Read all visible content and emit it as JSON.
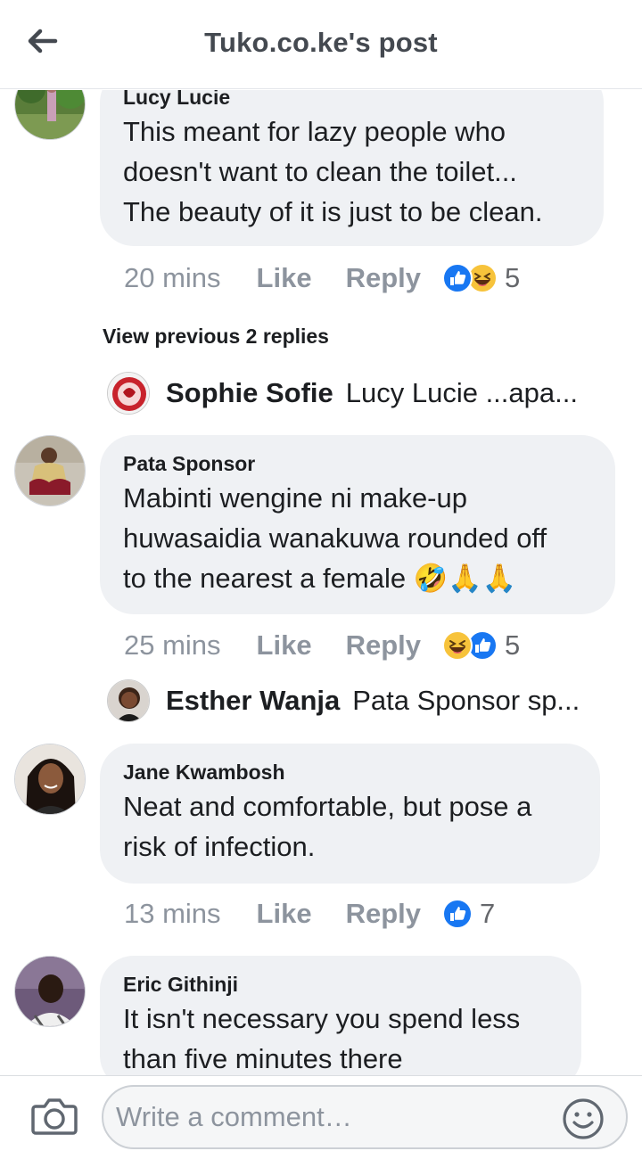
{
  "header": {
    "title": "Tuko.co.ke's post"
  },
  "comments": [
    {
      "author": "Lucy Lucie",
      "lines": [
        "This meant for lazy people who",
        "doesn't want to clean the toilet...",
        "The beauty of it is just to be clean."
      ],
      "time": "20 mins",
      "like": "Like",
      "reply": "Reply",
      "reactions": [
        "like",
        "laugh"
      ],
      "count": "5"
    },
    {
      "author": "Pata Sponsor",
      "lines": [
        "Mabinti wengine ni make-up",
        "huwasaidia wanakuwa rounded off",
        "to the nearest a female 🤣🙏🙏"
      ],
      "time": "25 mins",
      "like": "Like",
      "reply": "Reply",
      "reactions": [
        "laugh",
        "like"
      ],
      "count": "5"
    },
    {
      "author": "Jane Kwambosh",
      "lines": [
        "Neat and comfortable,  but pose a",
        "risk of infection."
      ],
      "time": "13 mins",
      "like": "Like",
      "reply": "Reply",
      "reactions": [
        "like"
      ],
      "count": "7"
    },
    {
      "author": "Eric Githinji",
      "lines": [
        "It isn't necessary you spend less",
        "than five minutes there"
      ]
    }
  ],
  "view_previous": "View previous 2 replies",
  "replies": [
    {
      "name": "Sophie Sofie",
      "text": "Lucy Lucie ...apa..."
    },
    {
      "name": "Esther Wanja",
      "text": "Pata Sponsor sp..."
    }
  ],
  "composer": {
    "placeholder": "Write a comment…"
  },
  "colors": {
    "like_blue": "#1877f2",
    "bubble": "#eff1f4",
    "muted": "#8d949e"
  }
}
